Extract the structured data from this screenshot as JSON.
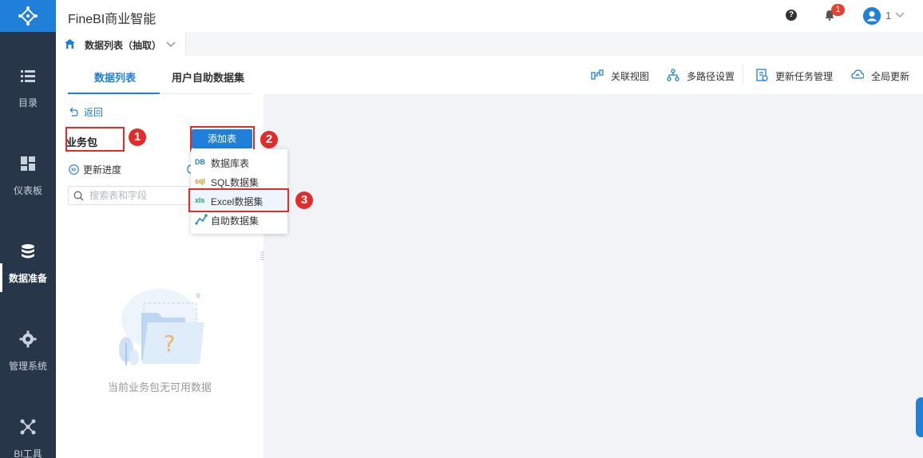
{
  "app": {
    "title": "FineBI商业智能"
  },
  "topbar": {
    "notification_count": "1",
    "user_name": "1"
  },
  "sidenav": {
    "items": [
      {
        "label": "目录",
        "icon": "list-icon"
      },
      {
        "label": "仪表板",
        "icon": "dashboard-icon"
      },
      {
        "label": "数据准备",
        "icon": "database-icon",
        "active": true
      },
      {
        "label": "管理系统",
        "icon": "gear-icon"
      },
      {
        "label": "BI工具",
        "icon": "bi-tools-icon"
      }
    ]
  },
  "doc_tab": {
    "label": "数据列表（抽取）"
  },
  "panel": {
    "tabs": [
      {
        "label": "数据列表",
        "active": true
      },
      {
        "label": "用户自助数据集"
      }
    ],
    "back_label": "返回",
    "package_title": "业务包",
    "add_table_label": "添加表",
    "update_progress_label": "更新进度",
    "search_placeholder": "搜索表和字段",
    "empty_message": "当前业务包无可用数据"
  },
  "dropdown": {
    "items": [
      {
        "icon_text": "DB",
        "label": "数据库表",
        "color": "#1f7fd9"
      },
      {
        "icon_text": "sql",
        "label": "SQL数据集",
        "color": "#f08a24"
      },
      {
        "icon_text": "xls",
        "label": "Excel数据集",
        "color": "#1aab6b",
        "highlighted": true
      },
      {
        "icon_text": "",
        "label": "自助数据集",
        "color": "#1f7fd9"
      }
    ]
  },
  "toolbar": {
    "items": [
      {
        "label": "关联视图",
        "icon": "relation-view-icon"
      },
      {
        "label": "多路径设置",
        "icon": "multi-path-icon"
      },
      {
        "label": "更新任务管理",
        "icon": "task-manage-icon"
      },
      {
        "label": "全局更新",
        "icon": "cloud-update-icon"
      }
    ]
  },
  "annotations": {
    "n1": "1",
    "n2": "2",
    "n3": "3"
  },
  "colors": {
    "accent": "#1f7fd9",
    "nav_bg": "#283649",
    "annotation": "#e32b2b"
  }
}
